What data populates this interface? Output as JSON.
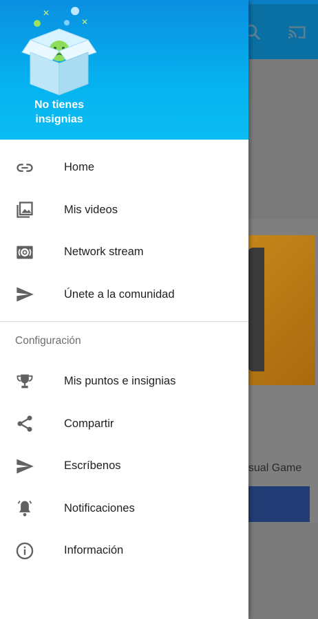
{
  "header": {
    "badge_text": "No tienes insignias"
  },
  "nav": {
    "main_items": [
      {
        "label": "Home",
        "icon": "link-icon"
      },
      {
        "label": "Mis videos",
        "icon": "photo-library-icon"
      },
      {
        "label": "Network stream",
        "icon": "stream-icon"
      },
      {
        "label": "Únete a la comunidad",
        "icon": "send-icon"
      }
    ],
    "section_title": "Configuración",
    "config_items": [
      {
        "label": "Mis puntos e insignias",
        "icon": "trophy-icon"
      },
      {
        "label": "Compartir",
        "icon": "share-icon"
      },
      {
        "label": "Escríbenos",
        "icon": "send-icon"
      },
      {
        "label": "Notificaciones",
        "icon": "bell-ringing-icon"
      },
      {
        "label": "Información",
        "icon": "info-icon"
      }
    ]
  },
  "background": {
    "caption": "asual Game",
    "appbar_color": "#0a6fa3",
    "header_color": "#05b2ef"
  }
}
